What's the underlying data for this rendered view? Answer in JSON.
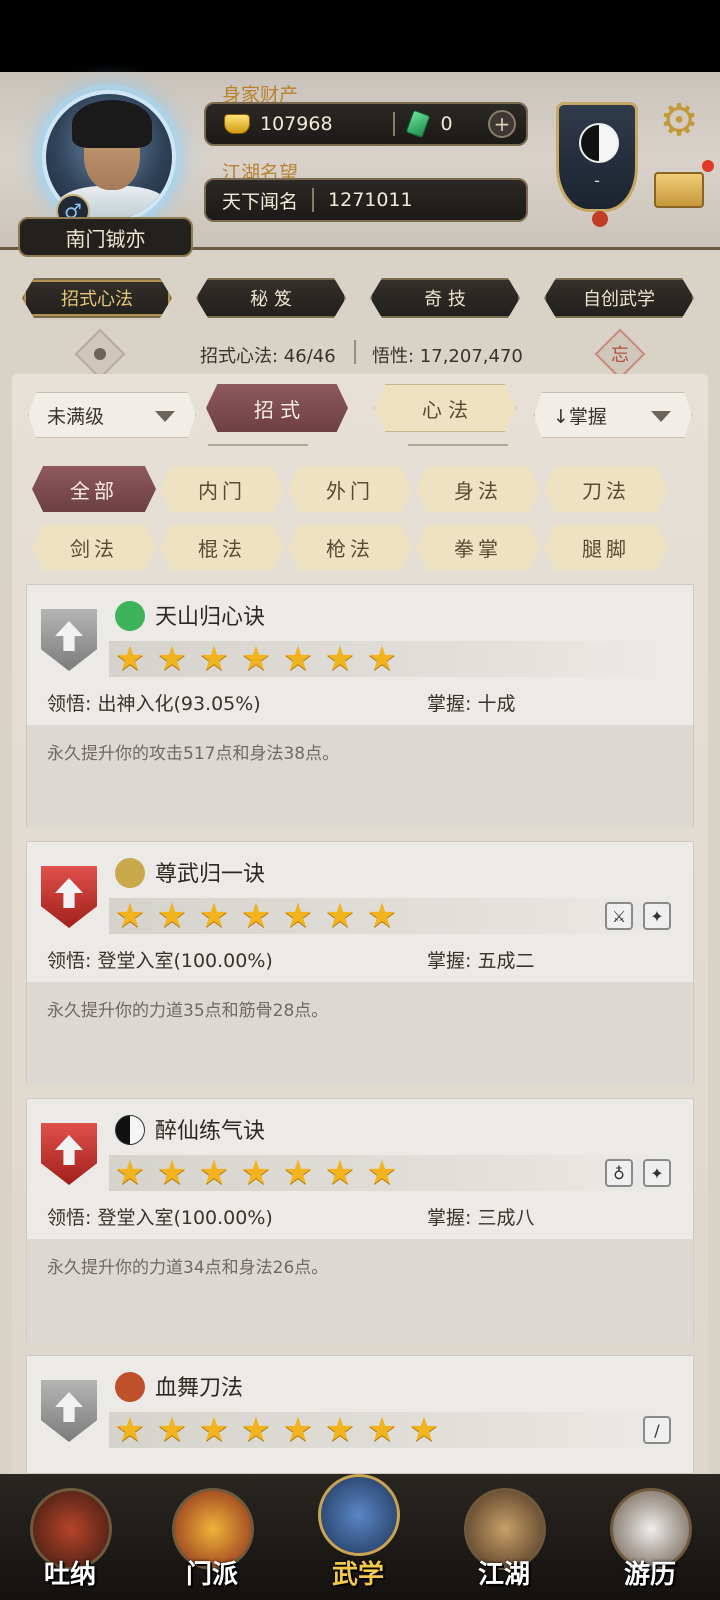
{
  "player": {
    "name": "南门铖亦",
    "gender_symbol": "♂"
  },
  "wealth": {
    "label": "身家财产",
    "gold": "107968",
    "jade": "0",
    "add": "+"
  },
  "fame": {
    "label": "江湖名望",
    "title": "天下闻名",
    "value": "1271011"
  },
  "emblem": {
    "dash": "-"
  },
  "top_tabs": [
    "招式心法",
    "秘 笈",
    "奇 技",
    "自创武学"
  ],
  "stats": {
    "moves": "招式心法: 46/46",
    "insight": "悟性: 17,207,470",
    "forget_char": "忘"
  },
  "filters": {
    "level_dropdown": "未满级",
    "mode_active": "招 式",
    "mode_inactive": "心 法",
    "sort_dropdown": "↓掌握"
  },
  "categories": [
    {
      "label": "全部",
      "active": true
    },
    {
      "label": "内门",
      "active": false
    },
    {
      "label": "外门",
      "active": false
    },
    {
      "label": "身法",
      "active": false
    },
    {
      "label": "刀法",
      "active": false
    },
    {
      "label": "剑法",
      "active": false
    },
    {
      "label": "棍法",
      "active": false
    },
    {
      "label": "枪法",
      "active": false
    },
    {
      "label": "拳掌",
      "active": false
    },
    {
      "label": "腿脚",
      "active": false
    }
  ],
  "skills": [
    {
      "name": "天山归心诀",
      "rank_color": "silver",
      "stars": 7,
      "comprehension": "领悟: 出神入化(93.05%)",
      "mastery": "掌握: 十成",
      "description": "永久提升你的攻击517点和身法38点。",
      "icon_color": "#3fb35a"
    },
    {
      "name": "尊武归一诀",
      "rank_color": "red",
      "stars": 7,
      "comprehension": "领悟: 登堂入室(100.00%)",
      "mastery": "掌握: 五成二",
      "description": "永久提升你的力道35点和筋骨28点。",
      "icon_color": "#c9a84b"
    },
    {
      "name": "醉仙练气诀",
      "rank_color": "red",
      "stars": 7,
      "comprehension": "领悟: 登堂入室(100.00%)",
      "mastery": "掌握: 三成八",
      "description": "永久提升你的力道34点和身法26点。",
      "icon_color": "#222222"
    },
    {
      "name": "血舞刀法",
      "rank_color": "silver",
      "stars": 8,
      "icon_color": "#c0502a"
    }
  ],
  "bottom_nav": [
    {
      "label": "吐纳",
      "active": false
    },
    {
      "label": "门派",
      "active": false
    },
    {
      "label": "武学",
      "active": true
    },
    {
      "label": "江湖",
      "active": false
    },
    {
      "label": "游历",
      "active": false
    }
  ]
}
